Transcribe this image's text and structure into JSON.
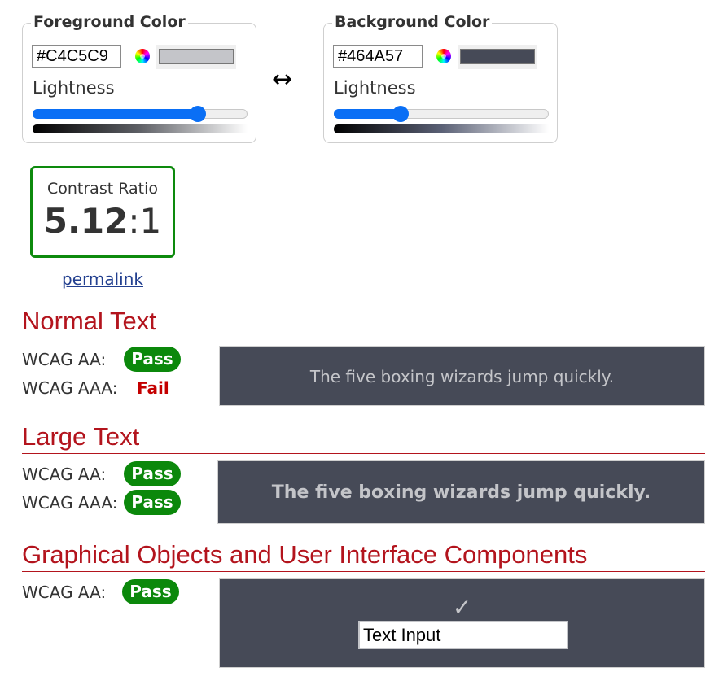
{
  "foreground": {
    "title": "Foreground Color",
    "hex_value": "#C4C5C9",
    "swatch_color": "#C4C5C9",
    "lightness_label": "Lightness",
    "lightness_percent": 77,
    "gradient_mid": "#5e6066"
  },
  "swap": {
    "icon": "↔"
  },
  "background": {
    "title": "Background Color",
    "hex_value": "#464A57",
    "swatch_color": "#464A57",
    "lightness_label": "Lightness",
    "lightness_percent": 31,
    "gradient_mid": "#5a6075"
  },
  "contrast": {
    "label": "Contrast Ratio",
    "ratio_bold": "5.12",
    "ratio_rest": ":1",
    "border_color": "#0d8a0d"
  },
  "permalink": {
    "label": "permalink"
  },
  "sections": {
    "normal": {
      "title": "Normal Text",
      "aa_label": "WCAG AA:",
      "aa_result": "Pass",
      "aaa_label": "WCAG AAA:",
      "aaa_result": "Fail",
      "preview_text": "The five boxing wizards jump quickly."
    },
    "large": {
      "title": "Large Text",
      "aa_label": "WCAG AA:",
      "aa_result": "Pass",
      "aaa_label": "WCAG AAA:",
      "aaa_result": "Pass",
      "preview_text": "The five boxing wizards jump quickly."
    },
    "graphical": {
      "title": "Graphical Objects and User Interface Components",
      "aa_label": "WCAG AA:",
      "aa_result": "Pass",
      "check_icon": "✓",
      "input_value": "Text Input"
    }
  },
  "colors": {
    "pass": "#0b880b",
    "fail": "#c40000",
    "heading": "#b3141d",
    "slider": "#0a6ff5"
  }
}
